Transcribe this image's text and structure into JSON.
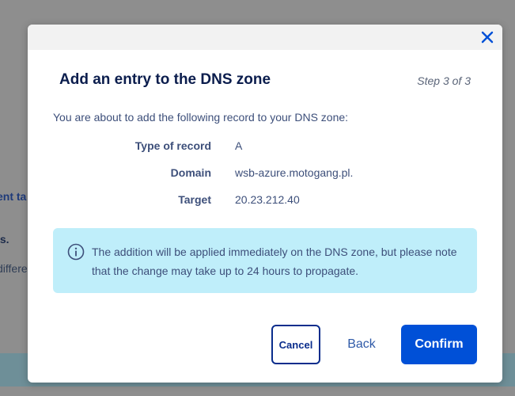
{
  "background": {
    "fragment_1": "ent ta",
    "fragment_2": "ls.",
    "fragment_3": "differe"
  },
  "modal": {
    "title": "Add an entry to the DNS zone",
    "step": "Step 3 of 3",
    "intro": "You are about to add the following record to your DNS zone:",
    "record": [
      {
        "label": "Type of record",
        "value": "A"
      },
      {
        "label": "Domain",
        "value": "wsb-azure.motogang.pl."
      },
      {
        "label": "Target",
        "value": "20.23.212.40"
      }
    ],
    "info": "The addition will be applied immediately on the DNS zone, but please note that the change may take up to 24 hours to propagate.",
    "buttons": {
      "cancel": "Cancel",
      "back": "Back",
      "confirm": "Confirm"
    }
  },
  "colors": {
    "primary": "#0050d7",
    "info_bg": "#bfeefa",
    "title": "#0b1d4d"
  },
  "icons": {
    "close": "close-icon",
    "info": "info-icon"
  }
}
